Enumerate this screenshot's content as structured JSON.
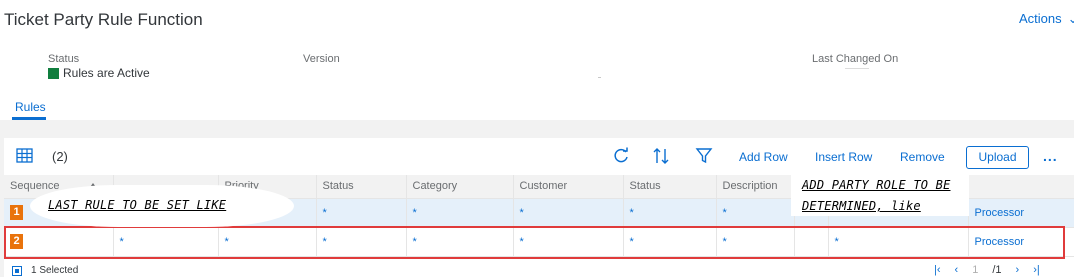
{
  "header": {
    "title": "Ticket Party Rule Function",
    "actions_label": "Actions",
    "attributes": [
      {
        "label": "Status",
        "value": "Rules are Active"
      },
      {
        "label": "Version",
        "value": ""
      },
      {
        "label": "Last Changed On",
        "value": ""
      }
    ],
    "status_color": "#107e3e"
  },
  "tabs": [
    "Rules"
  ],
  "toolbar": {
    "table_icon": "table-grid-icon",
    "count": "(2)",
    "refresh_icon": "refresh-icon",
    "sort_icon": "sort-icon",
    "filter_icon": "filter-icon",
    "add_row": "Add Row",
    "insert_row": "Insert Row",
    "remove": "Remove",
    "upload": "Upload",
    "more": "..."
  },
  "table": {
    "columns": [
      "Sequence",
      "",
      "Priority",
      "Status",
      "Category",
      "Customer",
      "Status",
      "Description",
      "",
      "",
      ""
    ],
    "rows": [
      {
        "seq": "1",
        "cells": [
          "",
          "",
          "*",
          "*",
          "*",
          "*",
          "*",
          "*",
          "",
          "",
          "Processor"
        ]
      },
      {
        "seq": "2",
        "cells": [
          "",
          "*",
          "*",
          "*",
          "*",
          "*",
          "*",
          "*",
          "",
          "*",
          "Processor"
        ]
      }
    ]
  },
  "footer": {
    "selected": "1 Selected",
    "page_current": "1",
    "page_total": "/1"
  },
  "annotations": {
    "left": "LAST RULE TO BE SET LIKE",
    "right_line1": "ADD PARTY ROLE TO BE",
    "right_line2": "DETERMINED, like"
  },
  "colors": {
    "accent": "#0a6ed1",
    "badge": "#e9730c",
    "highlight_box": "#e03b3b"
  }
}
